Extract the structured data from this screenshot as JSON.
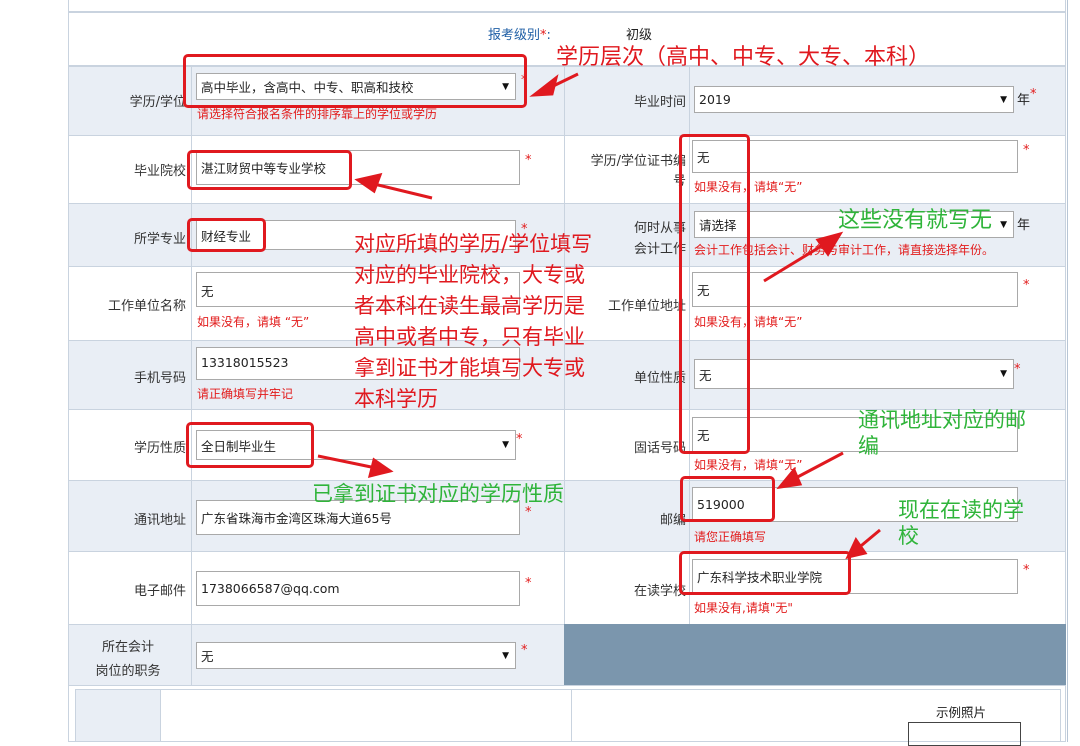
{
  "header": {
    "level_label": "报考级别",
    "level_value": "初级"
  },
  "form": {
    "edu_label": "学历/学位",
    "edu_value": "高中毕业，含高中、中专、职高和技校",
    "edu_hint": "请选择符合报名条件的排序靠上的学位或学历",
    "grad_time_label": "毕业时间",
    "grad_time_value": "2019",
    "grad_time_unit": "年",
    "school_label": "毕业院校",
    "school_value": "湛江财贸中等专业学校",
    "cert_no_label_1": "学历/学位证书编",
    "cert_no_label_2": "号",
    "cert_no_value": "无",
    "cert_no_hint": "如果没有，请填“无”",
    "major_label": "所学专业",
    "major_value": "财经专业",
    "work_start_label_1": "何时从事",
    "work_start_label_2": "会计工作",
    "work_start_value": "请选择",
    "work_start_unit": "年",
    "work_start_hint": "会计工作包括会计、财务与审计工作，请直接选择年份。",
    "employer_label": "工作单位名称",
    "employer_value": "无",
    "employer_hint": "如果没有，请填 “无”",
    "employer_addr_label": "工作单位地址",
    "employer_addr_value": "无",
    "employer_addr_hint": "如果没有，请填“无”",
    "phone_label": "手机号码",
    "phone_value": "13318015523",
    "phone_hint": "请正确填写并牢记",
    "unit_type_label": "单位性质",
    "unit_type_value": "无",
    "edu_type_label": "学历性质",
    "edu_type_value": "全日制毕业生",
    "tel_label": "固话号码",
    "tel_value": "无",
    "tel_hint": "如果没有，请填“无”",
    "address_label": "通讯地址",
    "address_value": "广东省珠海市金湾区珠海大道65号",
    "zip_label": "邮编",
    "zip_value": "519000",
    "zip_hint": "请您正确填写",
    "email_label": "电子邮件",
    "email_value": "1738066587@qq.com",
    "school_now_label": "在读学校",
    "school_now_value": "广东科学技术职业学院",
    "school_now_hint": "如果没有,请填\"无\"",
    "post_label_1": "所在会计",
    "post_label_2": "岗位的职务",
    "post_value": "无",
    "photo_label": "示例照片",
    "required_mark": "*"
  },
  "annotations": {
    "a1": "学历层次（高中、中专、大专、本科）",
    "a2_lines": [
      "对应所填的学历/学位填写",
      "对应的毕业院校，大专或",
      "者本科在读生最高学历是",
      "高中或者中专，只有毕业",
      "拿到证书才能填写大专或",
      "本科学历"
    ],
    "a3": "这些没有就写无",
    "a4_lines": [
      "通讯地址对应的邮",
      "编"
    ],
    "a5": "已拿到证书对应的学历性质",
    "a6_lines": [
      "现在在读的学",
      "校"
    ],
    "red_color": "#e0191f",
    "green_color": "#2fb43a"
  }
}
